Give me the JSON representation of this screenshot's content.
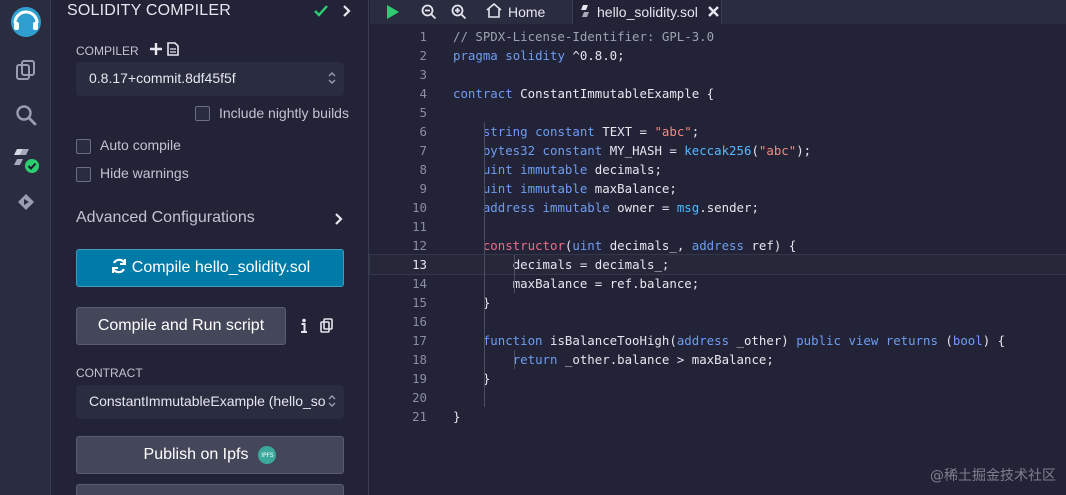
{
  "panel": {
    "title": "SOLIDITY COMPILER",
    "compiler_label": "COMPILER",
    "compiler_version": "0.8.17+commit.8df45f5f",
    "nightly_label": "Include nightly builds",
    "auto_compile_label": "Auto compile",
    "hide_warnings_label": "Hide warnings",
    "advanced_label": "Advanced Configurations",
    "compile_button": "Compile hello_solidity.sol",
    "compile_run_button": "Compile and Run script",
    "contract_label": "CONTRACT",
    "contract_value": "ConstantImmutableExample (hello_so",
    "publish_button": "Publish on Ipfs",
    "ipfs_badge": "IPFS"
  },
  "tabs": {
    "home": "Home",
    "file": "hello_solidity.sol"
  },
  "code": [
    {
      "n": "1",
      "t": "// SPDX-License-Identifier: GPL-3.0"
    },
    {
      "n": "2",
      "t": "pragma solidity ^0.8.0;"
    },
    {
      "n": "3",
      "t": ""
    },
    {
      "n": "4",
      "t": "contract ConstantImmutableExample {"
    },
    {
      "n": "5",
      "t": ""
    },
    {
      "n": "6",
      "t": "    string constant TEXT = \"abc\";"
    },
    {
      "n": "7",
      "t": "    bytes32 constant MY_HASH = keccak256(\"abc\");"
    },
    {
      "n": "8",
      "t": "    uint immutable decimals;"
    },
    {
      "n": "9",
      "t": "    uint immutable maxBalance;"
    },
    {
      "n": "10",
      "t": "    address immutable owner = msg.sender;"
    },
    {
      "n": "11",
      "t": ""
    },
    {
      "n": "12",
      "t": "    constructor(uint decimals_, address ref) {"
    },
    {
      "n": "13",
      "t": "        decimals = decimals_;"
    },
    {
      "n": "14",
      "t": "        maxBalance = ref.balance;"
    },
    {
      "n": "15",
      "t": "    }"
    },
    {
      "n": "16",
      "t": ""
    },
    {
      "n": "17",
      "t": "    function isBalanceTooHigh(address _other) public view returns (bool) {"
    },
    {
      "n": "18",
      "t": "        return _other.balance > maxBalance;"
    },
    {
      "n": "19",
      "t": "    }"
    },
    {
      "n": "20",
      "t": ""
    },
    {
      "n": "21",
      "t": "}"
    }
  ],
  "watermark": "@稀土掘金技术社区",
  "colors": {
    "accent": "#007aa6",
    "success": "#2ecc71",
    "background": "#222336",
    "rail": "#2a2c3f"
  }
}
